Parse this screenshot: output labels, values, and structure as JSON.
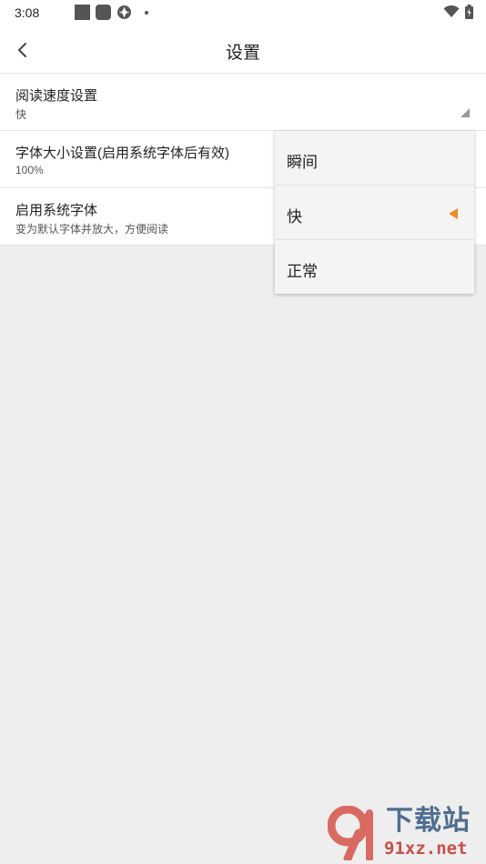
{
  "status_bar": {
    "time": "3:08"
  },
  "app_bar": {
    "title": "设置"
  },
  "settings": [
    {
      "title": "阅读速度设置",
      "subtitle": "快"
    },
    {
      "title": "字体大小设置(启用系统字体后有效)",
      "subtitle": "100%"
    },
    {
      "title": "启用系统字体",
      "subtitle": "变为默认字体并放大，方便阅读"
    }
  ],
  "dropdown": {
    "options": [
      "瞬间",
      "快",
      "正常"
    ],
    "selected": "快"
  },
  "watermark": {
    "text_cn": "下载站",
    "url": "91xz.net"
  },
  "colors": {
    "accent": "#f08a2a",
    "background": "#eeeeee",
    "surface": "#ffffff",
    "watermark_blue": "#4f6e90",
    "watermark_red": "#c7504a"
  }
}
